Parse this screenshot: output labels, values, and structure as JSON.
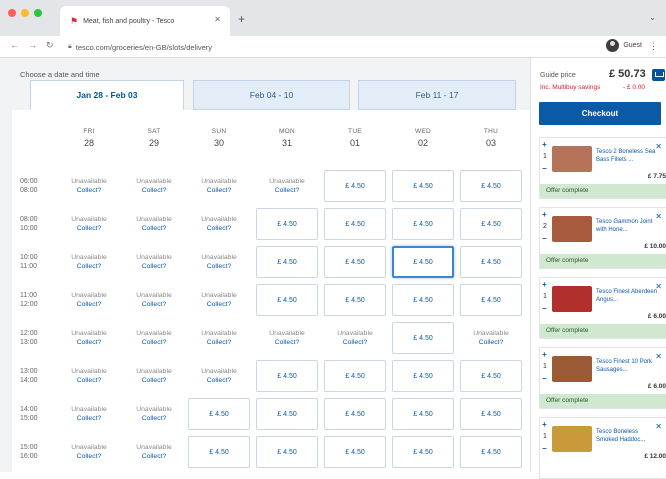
{
  "browser": {
    "tab_title": "Meat, fish and poultry - Tesco",
    "url": "tesco.com/groceries/en-GB/slots/delivery",
    "profile_name": "Guest",
    "traffic_lights": [
      "#ff5f57",
      "#febc2e",
      "#28c840"
    ]
  },
  "slots": {
    "heading": "Choose a date and time",
    "date_tabs": [
      {
        "label": "Jan 28 - Feb 03",
        "active": true
      },
      {
        "label": "Feb 04 - 10",
        "active": false
      },
      {
        "label": "Feb 11 - 17",
        "active": false
      }
    ],
    "days": [
      {
        "name": "FRI",
        "date": "28"
      },
      {
        "name": "SAT",
        "date": "29"
      },
      {
        "name": "SUN",
        "date": "30"
      },
      {
        "name": "MON",
        "date": "31"
      },
      {
        "name": "TUE",
        "date": "01"
      },
      {
        "name": "WED",
        "date": "02"
      },
      {
        "name": "THU",
        "date": "03"
      }
    ],
    "unavailable_label": "Unavailable",
    "collect_label": "Collect?",
    "rows": [
      {
        "start": "06:00",
        "end": "08:00",
        "cells": [
          "U",
          "U",
          "U",
          "U",
          "£ 4.50",
          "£ 4.50",
          "£ 4.50"
        ]
      },
      {
        "start": "08:00",
        "end": "10:00",
        "cells": [
          "U",
          "U",
          "U",
          "£ 4.50",
          "£ 4.50",
          "£ 4.50",
          "£ 4.50"
        ]
      },
      {
        "start": "10:00",
        "end": "11:00",
        "cells": [
          "U",
          "U",
          "U",
          "£ 4.50",
          "£ 4.50",
          "£ 4.50",
          "£ 4.50"
        ]
      },
      {
        "start": "11:00",
        "end": "12:00",
        "cells": [
          "U",
          "U",
          "U",
          "£ 4.50",
          "£ 4.50",
          "£ 4.50",
          "£ 4.50"
        ]
      },
      {
        "start": "12:00",
        "end": "13:00",
        "cells": [
          "U",
          "U",
          "U",
          "U",
          "U",
          "£ 4.50",
          "U"
        ]
      },
      {
        "start": "13:00",
        "end": "14:00",
        "cells": [
          "U",
          "U",
          "U",
          "£ 4.50",
          "£ 4.50",
          "£ 4.50",
          "£ 4.50"
        ]
      },
      {
        "start": "14:00",
        "end": "15:00",
        "cells": [
          "U",
          "U",
          "£ 4.50",
          "£ 4.50",
          "£ 4.50",
          "£ 4.50",
          "£ 4.50"
        ]
      },
      {
        "start": "15:00",
        "end": "16:00",
        "cells": [
          "U",
          "U",
          "£ 4.50",
          "£ 4.50",
          "£ 4.50",
          "£ 4.50",
          "£ 4.50"
        ]
      }
    ],
    "selected": {
      "row": 2,
      "col": 5
    }
  },
  "basket": {
    "guide_price_label": "Guide price",
    "guide_price_value": "£ 50.73",
    "savings_label": "Inc. Multibuy savings",
    "savings_value": "- £ 0.00",
    "checkout_label": "Checkout",
    "items": [
      {
        "qty": "1",
        "name": "Tesco 2 Boneless Sea Bass Fillets ...",
        "price": "£ 7.75",
        "offer": "Offer complete",
        "thumb_color": "#b5745a"
      },
      {
        "qty": "2",
        "name": "Tesco Gammon Joint with Hone...",
        "price": "£ 10.00",
        "offer": "Offer complete",
        "thumb_color": "#a85a3c"
      },
      {
        "qty": "1",
        "name": "Tesco Finest Aberdeen Angus...",
        "price": "£ 6.00",
        "offer": "Offer complete",
        "thumb_color": "#b2302c"
      },
      {
        "qty": "1",
        "name": "Tesco Finest 10 Pork Sausages...",
        "price": "£ 6.00",
        "offer": "Offer complete",
        "thumb_color": "#9a5a36"
      },
      {
        "qty": "1",
        "name": "Tesco Boneless Smoked Haddoc...",
        "price": "£ 12.00",
        "offer": "",
        "thumb_color": "#c89a3a"
      }
    ]
  }
}
